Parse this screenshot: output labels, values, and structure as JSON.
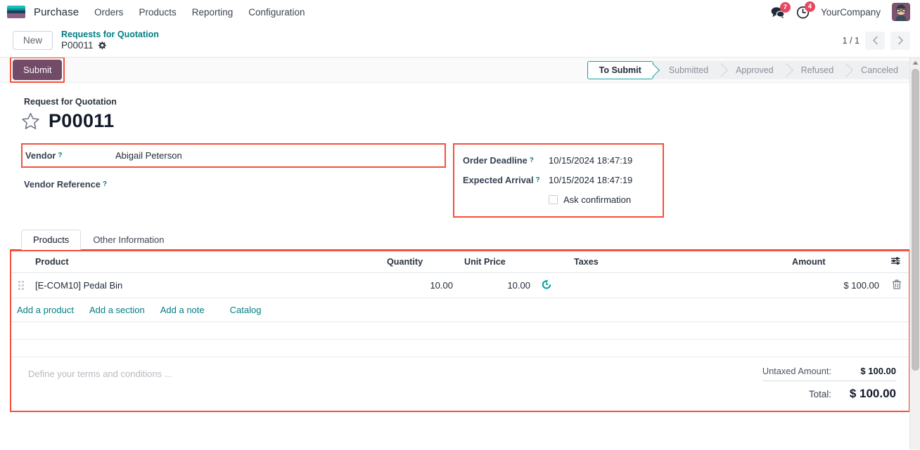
{
  "navbar": {
    "logo_icon": "odoo-logo",
    "app_name": "Purchase",
    "menu": [
      {
        "label": "Orders"
      },
      {
        "label": "Products"
      },
      {
        "label": "Reporting"
      },
      {
        "label": "Configuration"
      }
    ],
    "messages_icon": "chat-bubble-icon",
    "messages_badge": "7",
    "activities_icon": "clock-icon",
    "activities_badge": "4",
    "company": "YourCompany",
    "avatar_icon": "user-avatar"
  },
  "breadcrumb": {
    "new_label": "New",
    "parent": "Requests for Quotation",
    "current": "P00011",
    "gear_icon": "gear-icon",
    "pager_value": "1 / 1",
    "prev_icon": "chevron-left-icon",
    "next_icon": "chevron-right-icon"
  },
  "control_panel": {
    "submit_label": "Submit",
    "statusbar": [
      {
        "label": "To Submit",
        "active": true
      },
      {
        "label": "Submitted",
        "active": false
      },
      {
        "label": "Approved",
        "active": false
      },
      {
        "label": "Refused",
        "active": false
      },
      {
        "label": "Canceled",
        "active": false
      }
    ]
  },
  "record": {
    "type_label": "Request for Quotation",
    "star_icon": "star-outline-icon",
    "name": "P00011",
    "fields_left": [
      {
        "label": "Vendor",
        "help": "?",
        "value": "Abigail Peterson",
        "highlighted": true
      },
      {
        "label": "Vendor Reference",
        "help": "?",
        "value": "",
        "highlighted": false
      }
    ],
    "fields_right": [
      {
        "label": "Order Deadline",
        "help": "?",
        "value": "10/15/2024 18:47:19"
      },
      {
        "label": "Expected Arrival",
        "help": "?",
        "value": "10/15/2024 18:47:19"
      }
    ],
    "ask_confirmation": {
      "label": "Ask confirmation",
      "checked": false
    }
  },
  "notebook": {
    "tabs": [
      {
        "label": "Products",
        "active": true
      },
      {
        "label": "Other Information",
        "active": false
      }
    ]
  },
  "lines_table": {
    "columns": {
      "product": "Product",
      "quantity": "Quantity",
      "unit_price": "Unit Price",
      "taxes": "Taxes",
      "amount": "Amount"
    },
    "optional_columns_icon": "column-options-icon",
    "rows": [
      {
        "drag_icon": "drag-handle-icon",
        "product": "[E-COM10] Pedal Bin",
        "quantity": "10.00",
        "unit_price": "10.00",
        "reset_icon": "reset-price-icon",
        "taxes": "",
        "amount": "$ 100.00",
        "delete_icon": "trash-icon"
      }
    ],
    "links": [
      {
        "label": "Add a product"
      },
      {
        "label": "Add a section"
      },
      {
        "label": "Add a note"
      }
    ],
    "catalog_label": "Catalog"
  },
  "footer": {
    "terms_placeholder": "Define your terms and conditions ...",
    "untaxed_label": "Untaxed Amount:",
    "untaxed_value": "$ 100.00",
    "total_label": "Total:",
    "total_value": "$ 100.00"
  },
  "colors": {
    "brand_purple": "#714B67",
    "accent_teal": "#017E84",
    "status_active_border": "#14A3A1",
    "highlight_red": "#F5503C",
    "badge_red": "#E7485F"
  }
}
